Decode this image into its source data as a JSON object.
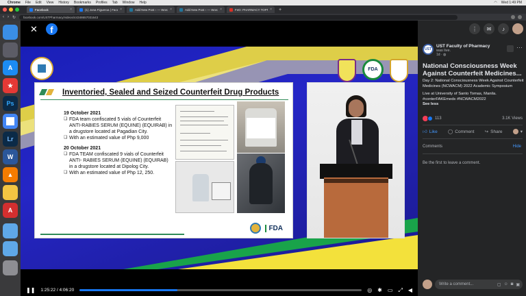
{
  "menubar": {
    "app": "Chrome",
    "items": [
      "File",
      "Edit",
      "View",
      "History",
      "Bookmarks",
      "Profiles",
      "Tab",
      "Window",
      "Help"
    ],
    "clock": "Wed 1:49 PM"
  },
  "tabs": [
    {
      "label": "Facebook",
      "color": "#1877f2",
      "active": true
    },
    {
      "label": "(1) Jona Figueroa | Facebook",
      "color": "#1877f2",
      "active": false
    },
    {
      "label": "Add New Post ‹ — WordPress",
      "color": "#21759b",
      "active": false
    },
    {
      "label": "Add New Post ‹ — WordPress",
      "color": "#21759b",
      "active": false
    },
    {
      "label": "FeD: PHARMACY TOPNOTCH...",
      "color": "#d93025",
      "active": false
    }
  ],
  "address": {
    "url": "facebook.com/USTPharmacy/videos/44348657031643"
  },
  "viewer": {
    "close_icon": "close-icon",
    "logo_letter": "f"
  },
  "slide": {
    "title": "Inventoried, Sealed and Seized Counterfeit Drug Products",
    "stripe_colors": [
      "#2e8b57",
      "#e2b33c"
    ],
    "entries": [
      {
        "date": "19 October 2021",
        "bullets": [
          "FDA team confiscated 5 vials of Counterfeit ANTI-RABIES SERUM (EQUINE) (EQUIRAB) in a drugstore located at Pagadian City.",
          "With an estimated value of Php 9,000"
        ]
      },
      {
        "date": "20 October 2021",
        "bullets": [
          "FDA TEAM confiscated 9 vials of Counterfeit ANTI- RABIES SERUM (EQUINE) (EQUIRAB) in a drugstore located at Dipolog City.",
          "With an estimated value of Php 12, 250."
        ]
      }
    ],
    "footer_logo_text": "FDA"
  },
  "stage_logos": {
    "fda_text": "FDA"
  },
  "player": {
    "time": "1:25:22 / 4:06:20",
    "progress": 0.347
  },
  "panel": {
    "page_avatar_text": "UST",
    "page_name": "UST Faculty of Pharmacy",
    "page_sub": "was live.",
    "page_time": "1d · ",
    "title_line1": "National Consciousness Week",
    "title_line2": "Against Counterfeit Medicines...",
    "body1": "Day 2: National Consciousness Week Against Counterfeit Medicines (NCWACM) 2022 Academic Symposium",
    "body2": "Live at University of Santo Tomas, Manila.",
    "hashtags": "#conterFAKEmeds #NCWACM2022",
    "see_less": "See less",
    "reaction_count": "113",
    "views": "3.1K Views",
    "like_label": "Like",
    "comment_label": "Comment",
    "share_label": "Share",
    "comments_tab": "Comments",
    "hide_label": "Hide",
    "first_comment": "Be the first to leave a comment.",
    "comment_placeholder": "Write a comment..."
  },
  "dock": [
    {
      "name": "finder",
      "color": "#3a8ee6",
      "glyph": ""
    },
    {
      "name": "launchpad",
      "color": "#5c5c66",
      "glyph": ""
    },
    {
      "name": "app-store",
      "color": "#1c8cf2",
      "glyph": "A"
    },
    {
      "name": "app-red",
      "color": "#e53935",
      "glyph": "★"
    },
    {
      "name": "photoshop",
      "color": "#0b2a47",
      "glyph": "Ps"
    },
    {
      "name": "chrome",
      "color": "#4285f4",
      "glyph": ""
    },
    {
      "name": "lightroom",
      "color": "#0b2a47",
      "glyph": "Lr"
    },
    {
      "name": "word",
      "color": "#2b579a",
      "glyph": "W"
    },
    {
      "name": "vlc",
      "color": "#f57c00",
      "glyph": "▲"
    },
    {
      "name": "notes",
      "color": "#f4c542",
      "glyph": ""
    },
    {
      "name": "acrobat",
      "color": "#d32f2f",
      "glyph": "A"
    },
    {
      "name": "folder",
      "color": "#5fa8e8",
      "glyph": ""
    },
    {
      "name": "folder-2",
      "color": "#5fa8e8",
      "glyph": ""
    },
    {
      "name": "trash",
      "color": "#8e8e93",
      "glyph": ""
    }
  ]
}
